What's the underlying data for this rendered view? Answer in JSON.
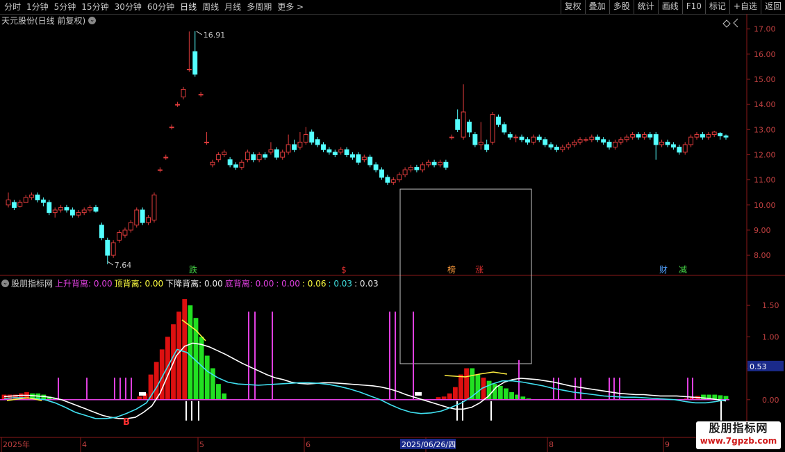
{
  "toolbar": {
    "periods": [
      "分时",
      "1分钟",
      "5分钟",
      "15分钟",
      "30分钟",
      "60分钟",
      "日线",
      "周线",
      "月线",
      "多周期",
      "更多 >"
    ],
    "active_period": "日线",
    "buttons": [
      "复权",
      "叠加",
      "多股",
      "统计",
      "画线",
      "F10",
      "标记",
      "+自选",
      "返回"
    ]
  },
  "title": "天元股份(日线 前复权)",
  "price_axis": [
    "17.00",
    "16.00",
    "15.00",
    "14.00",
    "13.00",
    "12.00",
    "11.00",
    "10.00",
    "9.00",
    "8.00"
  ],
  "annotations": {
    "high": "16.91",
    "low": "7.64"
  },
  "event_markers": [
    {
      "label": "跌",
      "color": "#46d246"
    },
    {
      "label": "$",
      "color": "#e03030"
    },
    {
      "label": "榜",
      "color": "#ff9c3c"
    },
    {
      "label": "涨",
      "color": "#e03030"
    },
    {
      "label": "财",
      "color": "#50a0ff"
    },
    {
      "label": "减",
      "color": "#46d246"
    }
  ],
  "indicator": {
    "name": "股朋指标网",
    "items": [
      {
        "label": "上升背离:",
        "value": "0.00",
        "color": "#e040e0"
      },
      {
        "label": "顶背离:",
        "value": "0.00",
        "color": "#ffff40"
      },
      {
        "label": "下降背离:",
        "value": "0.00",
        "color": "#e8e8e8"
      },
      {
        "label": "底背离:",
        "value": "0.00",
        "color": "#e040e0"
      },
      {
        "label": ":",
        "value": "0.00",
        "color": "#e040e0"
      },
      {
        "label": ":",
        "value": "0.06",
        "color": "#ffff40"
      },
      {
        "label": ":",
        "value": "0.03",
        "color": "#40e0e0"
      },
      {
        "label": ":",
        "value": "0.03",
        "color": "#e8e8e8"
      }
    ],
    "axis": [
      "1.50",
      "1.00",
      "0.50",
      "0.00"
    ],
    "current_value": "0.53",
    "buy_marker": "B"
  },
  "time_axis": [
    "2025年",
    "4",
    "5",
    "6",
    "7",
    "8",
    "9"
  ],
  "cursor_date": "2025/06/26/四",
  "watermark": {
    "title": "股朋指标网",
    "url": "www.7gpzb.com"
  },
  "colors": {
    "up": "#e03c3c",
    "down": "#54ffff",
    "bg": "#000000",
    "grid": "#8b1a1a"
  },
  "chart_data": {
    "type": "candlestick",
    "ylim": [
      7.6,
      17.2
    ],
    "candles": [
      [
        10.0,
        10.2,
        10.5,
        9.9
      ],
      [
        10.1,
        9.9,
        10.2,
        9.8
      ],
      [
        9.95,
        10.1,
        10.2,
        9.9
      ],
      [
        10.1,
        10.3,
        10.4,
        10.1
      ],
      [
        10.3,
        10.4,
        10.5,
        10.2
      ],
      [
        10.4,
        10.2,
        10.5,
        10.1
      ],
      [
        10.2,
        10.1,
        10.3,
        9.95
      ],
      [
        10.1,
        9.7,
        10.2,
        9.6
      ],
      [
        9.7,
        9.8,
        9.9,
        9.5
      ],
      [
        9.8,
        9.9,
        10.0,
        9.7
      ],
      [
        9.9,
        9.8,
        10.0,
        9.7
      ],
      [
        9.8,
        9.6,
        9.9,
        9.5
      ],
      [
        9.6,
        9.7,
        9.8,
        9.5
      ],
      [
        9.7,
        9.8,
        9.9,
        9.6
      ],
      [
        9.8,
        9.9,
        10.0,
        9.7
      ],
      [
        9.9,
        9.75,
        10.0,
        9.7
      ],
      [
        9.2,
        8.7,
        9.3,
        8.6
      ],
      [
        8.6,
        8.0,
        8.7,
        7.64
      ],
      [
        8.0,
        8.5,
        8.6,
        7.9
      ],
      [
        8.6,
        8.9,
        9.0,
        8.5
      ],
      [
        8.8,
        9.0,
        9.1,
        8.7
      ],
      [
        9.0,
        9.3,
        9.4,
        8.9
      ],
      [
        9.2,
        9.8,
        9.9,
        9.1
      ],
      [
        9.8,
        9.3,
        9.9,
        9.2
      ],
      [
        9.3,
        9.5,
        9.6,
        9.2
      ],
      [
        9.4,
        10.4,
        10.5,
        9.3
      ],
      [
        11.4,
        11.4,
        11.5,
        11.3
      ],
      [
        11.9,
        11.9,
        12.0,
        11.8
      ],
      [
        13.1,
        13.1,
        13.2,
        13.0
      ],
      [
        14.0,
        14.0,
        14.1,
        13.9
      ],
      [
        14.3,
        14.6,
        14.7,
        14.2
      ],
      [
        15.4,
        15.4,
        16.9,
        15.3
      ],
      [
        16.1,
        15.2,
        16.91,
        15.1
      ],
      [
        14.4,
        14.4,
        14.5,
        14.3
      ],
      [
        12.5,
        12.5,
        12.9,
        12.4
      ],
      [
        11.6,
        11.7,
        11.8,
        11.5
      ],
      [
        11.8,
        12.0,
        12.1,
        11.7
      ],
      [
        12.0,
        12.1,
        12.2,
        11.9
      ],
      [
        11.8,
        11.6,
        11.9,
        11.5
      ],
      [
        11.6,
        11.5,
        11.7,
        11.4
      ],
      [
        11.5,
        11.7,
        11.8,
        11.4
      ],
      [
        11.8,
        12.1,
        12.2,
        11.7
      ],
      [
        12.0,
        11.8,
        12.1,
        11.7
      ],
      [
        11.8,
        12.0,
        12.1,
        11.7
      ],
      [
        12.0,
        11.9,
        12.1,
        11.8
      ],
      [
        12.1,
        12.2,
        12.5,
        12.0
      ],
      [
        12.2,
        11.9,
        12.3,
        11.8
      ],
      [
        11.9,
        12.1,
        12.2,
        11.8
      ],
      [
        12.1,
        12.4,
        12.8,
        12.0
      ],
      [
        12.4,
        12.2,
        12.6,
        12.1
      ],
      [
        12.3,
        12.5,
        12.9,
        12.2
      ],
      [
        12.5,
        12.8,
        13.1,
        12.4
      ],
      [
        12.9,
        12.5,
        13.0,
        12.4
      ],
      [
        12.6,
        12.4,
        12.7,
        12.3
      ],
      [
        12.4,
        12.2,
        12.5,
        12.1
      ],
      [
        12.2,
        12.1,
        12.3,
        12.0
      ],
      [
        12.1,
        12.0,
        12.2,
        11.9
      ],
      [
        12.1,
        12.2,
        12.3,
        12.0
      ],
      [
        12.2,
        12.0,
        12.3,
        11.9
      ],
      [
        12.0,
        11.9,
        12.1,
        11.8
      ],
      [
        12.0,
        11.7,
        12.1,
        11.6
      ],
      [
        11.8,
        11.9,
        12.0,
        11.7
      ],
      [
        11.9,
        11.6,
        12.0,
        11.5
      ],
      [
        11.6,
        11.4,
        11.7,
        11.3
      ],
      [
        11.4,
        11.1,
        11.5,
        11.0
      ],
      [
        11.1,
        10.9,
        11.2,
        10.8
      ],
      [
        10.9,
        11.0,
        11.1,
        10.8
      ],
      [
        11.0,
        11.2,
        11.3,
        10.9
      ],
      [
        11.2,
        11.4,
        11.5,
        11.1
      ],
      [
        11.4,
        11.5,
        11.6,
        11.3
      ],
      [
        11.5,
        11.4,
        11.6,
        11.3
      ],
      [
        11.4,
        11.6,
        11.7,
        11.3
      ],
      [
        11.6,
        11.7,
        11.8,
        11.5
      ],
      [
        11.7,
        11.6,
        11.8,
        11.5
      ],
      [
        11.6,
        11.7,
        11.8,
        11.5
      ],
      [
        11.7,
        11.5,
        11.8,
        11.4
      ],
      [
        12.7,
        12.7,
        12.8,
        12.6
      ],
      [
        13.4,
        13.0,
        13.8,
        12.9
      ],
      [
        12.7,
        13.7,
        14.8,
        12.6
      ],
      [
        13.3,
        12.9,
        13.4,
        12.7
      ],
      [
        12.8,
        12.4,
        12.9,
        12.3
      ],
      [
        12.4,
        12.5,
        13.3,
        12.2
      ],
      [
        12.4,
        12.2,
        12.6,
        12.1
      ],
      [
        12.5,
        13.6,
        13.7,
        12.4
      ],
      [
        13.5,
        13.2,
        13.6,
        13.1
      ],
      [
        13.2,
        12.9,
        13.3,
        12.8
      ],
      [
        12.8,
        12.7,
        12.9,
        12.6
      ],
      [
        12.7,
        12.7,
        12.8,
        12.5
      ],
      [
        12.7,
        12.6,
        12.8,
        12.5
      ],
      [
        12.6,
        12.5,
        12.7,
        12.4
      ],
      [
        12.5,
        12.7,
        12.8,
        12.4
      ],
      [
        12.7,
        12.6,
        12.8,
        12.5
      ],
      [
        12.6,
        12.4,
        12.7,
        12.3
      ],
      [
        12.4,
        12.3,
        12.5,
        12.2
      ],
      [
        12.3,
        12.2,
        12.4,
        12.1
      ],
      [
        12.2,
        12.3,
        12.4,
        12.1
      ],
      [
        12.3,
        12.4,
        12.5,
        12.2
      ],
      [
        12.4,
        12.5,
        12.6,
        12.3
      ],
      [
        12.5,
        12.6,
        12.7,
        12.4
      ],
      [
        12.6,
        12.6,
        12.7,
        12.5
      ],
      [
        12.6,
        12.7,
        12.8,
        12.5
      ],
      [
        12.7,
        12.6,
        12.8,
        12.5
      ],
      [
        12.6,
        12.5,
        12.7,
        12.4
      ],
      [
        12.5,
        12.3,
        12.6,
        12.2
      ],
      [
        12.3,
        12.5,
        12.6,
        12.2
      ],
      [
        12.5,
        12.6,
        12.7,
        12.4
      ],
      [
        12.6,
        12.7,
        12.8,
        12.5
      ],
      [
        12.7,
        12.8,
        12.9,
        12.6
      ],
      [
        12.8,
        12.7,
        12.9,
        12.6
      ],
      [
        12.7,
        12.8,
        12.9,
        12.6
      ],
      [
        12.8,
        12.7,
        12.9,
        12.6
      ],
      [
        12.8,
        12.4,
        12.9,
        11.8
      ],
      [
        12.4,
        12.5,
        12.6,
        12.3
      ],
      [
        12.5,
        12.4,
        12.6,
        12.3
      ],
      [
        12.4,
        12.3,
        12.5,
        12.2
      ],
      [
        12.3,
        12.1,
        12.4,
        12.0
      ],
      [
        12.1,
        12.4,
        12.5,
        12.0
      ],
      [
        12.4,
        12.7,
        12.8,
        12.3
      ],
      [
        12.7,
        12.8,
        12.9,
        12.6
      ],
      [
        12.8,
        12.7,
        12.9,
        12.6
      ],
      [
        12.7,
        12.8,
        12.9,
        12.6
      ],
      [
        12.8,
        12.9,
        12.95,
        12.7
      ],
      [
        12.85,
        12.75,
        12.9,
        12.6
      ],
      [
        12.75,
        12.7,
        12.8,
        12.6
      ]
    ],
    "indicator_ylim": [
      -0.5,
      1.8
    ],
    "histogram": [
      0.08,
      0.08,
      0.08,
      0.1,
      0.12,
      0.1,
      0.1,
      0.08,
      0.05,
      0.02,
      0,
      0,
      0,
      0,
      0,
      0,
      0,
      0,
      0,
      0,
      0,
      0,
      0,
      0,
      0.05,
      0.1,
      0.4,
      0.6,
      0.8,
      1.0,
      1.2,
      1.4,
      1.6,
      1.5,
      1.3,
      1.0,
      0.7,
      0.5,
      0.25,
      0.1,
      0,
      0,
      0,
      0,
      0,
      0,
      0,
      0,
      0,
      0,
      0,
      0,
      0,
      0,
      0,
      0,
      0,
      0,
      0,
      0,
      0,
      0,
      0,
      0,
      0,
      0,
      0,
      0,
      0,
      0,
      0,
      0,
      0,
      0,
      0,
      0,
      0,
      0.04,
      0.05,
      0.1,
      0.2,
      0.4,
      0.5,
      0.5,
      0.4,
      0.35,
      0.3,
      0.25,
      0.22,
      0.18,
      0.12,
      0.08,
      0.05,
      0.02,
      0,
      0,
      0,
      0,
      0,
      0,
      0,
      0,
      0,
      0,
      0,
      0,
      0,
      0,
      0,
      0,
      0,
      0,
      0,
      0,
      0,
      0,
      0,
      0,
      0,
      0,
      0,
      0.02,
      0.04,
      0.06,
      0.08,
      0.08,
      0.08,
      0.07,
      0.06
    ],
    "hist_color": [
      "r",
      "r",
      "r",
      "r",
      "r",
      "g",
      "g",
      "g",
      "g",
      "g",
      "n",
      "n",
      "n",
      "n",
      "n",
      "n",
      "n",
      "n",
      "n",
      "n",
      "n",
      "n",
      "n",
      "n",
      "r",
      "r",
      "r",
      "r",
      "r",
      "r",
      "r",
      "r",
      "r",
      "g",
      "g",
      "g",
      "g",
      "g",
      "g",
      "g",
      "n",
      "n",
      "n",
      "n",
      "n",
      "n",
      "n",
      "n",
      "n",
      "n",
      "n",
      "n",
      "n",
      "n",
      "n",
      "n",
      "n",
      "n",
      "n",
      "n",
      "n",
      "n",
      "n",
      "n",
      "n",
      "n",
      "n",
      "n",
      "n",
      "n",
      "n",
      "n",
      "n",
      "n",
      "n",
      "n",
      "n",
      "r",
      "r",
      "r",
      "r",
      "r",
      "r",
      "g",
      "g",
      "r",
      "g",
      "g",
      "g",
      "g",
      "g",
      "g",
      "g",
      "g",
      "n",
      "n",
      "n",
      "n",
      "n",
      "n",
      "n",
      "n",
      "n",
      "n",
      "n",
      "n",
      "n",
      "n",
      "n",
      "n",
      "n",
      "n",
      "n",
      "n",
      "n",
      "n",
      "n",
      "n",
      "n",
      "n",
      "n",
      "r",
      "r",
      "r",
      "g",
      "g",
      "g",
      "g",
      "g"
    ],
    "white_line": [
      0.05,
      0.06,
      0.07,
      0.07,
      0.06,
      0.05,
      0.03,
      0.0,
      -0.05,
      -0.1,
      -0.15,
      -0.2,
      -0.25,
      -0.28,
      -0.3,
      -0.3,
      -0.28,
      -0.2,
      -0.1,
      0.1,
      0.4,
      0.7,
      0.85,
      0.9,
      0.88,
      0.84,
      0.78,
      0.72,
      0.65,
      0.58,
      0.52,
      0.46,
      0.4,
      0.35,
      0.32,
      0.28,
      0.26,
      0.25,
      0.26,
      0.27,
      0.27,
      0.26,
      0.25,
      0.24,
      0.23,
      0.22,
      0.2,
      0.17,
      0.13,
      0.08,
      0.04,
      0.0,
      -0.04,
      -0.08,
      -0.12,
      -0.15,
      -0.15,
      -0.12,
      -0.05,
      0.05,
      0.2,
      0.28,
      0.32,
      0.34,
      0.33,
      0.32,
      0.3,
      0.28,
      0.25,
      0.22,
      0.2,
      0.18,
      0.16,
      0.14,
      0.12,
      0.1,
      0.09,
      0.08,
      0.08,
      0.07,
      0.06,
      0.06,
      0.06,
      0.05,
      0.04,
      0.03,
      0.02,
      0.0,
      -0.02
    ],
    "cyan_line": [
      0.02,
      0.03,
      0.03,
      0.02,
      0.0,
      -0.05,
      -0.12,
      -0.2,
      -0.25,
      -0.3,
      -0.3,
      -0.28,
      -0.22,
      -0.15,
      -0.05,
      0.2,
      0.5,
      0.8,
      0.75,
      0.6,
      0.45,
      0.35,
      0.28,
      0.25,
      0.24,
      0.23,
      0.24,
      0.25,
      0.26,
      0.27,
      0.27,
      0.26,
      0.24,
      0.21,
      0.17,
      0.12,
      0.06,
      0.0,
      -0.08,
      -0.15,
      -0.2,
      -0.22,
      -0.21,
      -0.18,
      -0.12,
      -0.05,
      0.05,
      0.18,
      0.25,
      0.3,
      0.3,
      0.28,
      0.25,
      0.22,
      0.18,
      0.15,
      0.12,
      0.1,
      0.08,
      0.06,
      0.05,
      0.04,
      0.04,
      0.03,
      0.02,
      0.01,
      0.0,
      -0.03,
      -0.05,
      -0.05,
      -0.03,
      0.0
    ]
  }
}
